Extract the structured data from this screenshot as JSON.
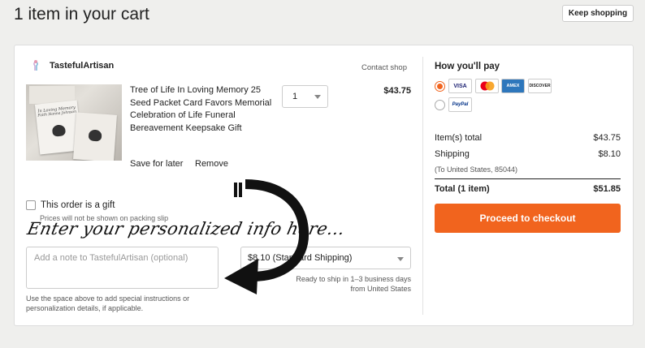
{
  "header": {
    "title": "1 item in your cart",
    "keep_shopping": "Keep shopping"
  },
  "shop": {
    "name": "TastefulArtisan",
    "contact": "Contact shop"
  },
  "item": {
    "title": "Tree of Life In Loving Memory 25 Seed Packet Card Favors Memorial Celebration of Life Funeral Bereavement Keepsake Gift",
    "quantity": "1",
    "price": "$43.75",
    "save_later": "Save for later",
    "remove": "Remove",
    "thumb_text_1": "In Loving Memory",
    "thumb_text_2": "Faith Hanna Johnson"
  },
  "gift": {
    "label": "This order is a gift",
    "sub": "Prices will not be shown on packing slip"
  },
  "annotation": {
    "text": "Enter your personalized info here..."
  },
  "note": {
    "placeholder": "Add a note to TastefulArtisan (optional)",
    "help": "Use the space above to add special instructions or personalization details, if applicable."
  },
  "shipping": {
    "selected": "$8.10 (Standard Shipping)",
    "info_line1": "Ready to ship in 1–3 business days",
    "info_line2": "from United States"
  },
  "payment": {
    "title": "How you'll pay",
    "methods": [
      "VISA",
      "Mastercard",
      "AMEX",
      "DISCOVER",
      "PayPal"
    ],
    "selected": "cards"
  },
  "summary": {
    "items_total_label": "Item(s) total",
    "items_total_value": "$43.75",
    "shipping_label": "Shipping",
    "shipping_value": "$8.10",
    "ship_to": "(To United States, 85044)",
    "total_label": "Total (1 item)",
    "total_value": "$51.85",
    "checkout": "Proceed to checkout"
  },
  "colors": {
    "accent": "#f1641e",
    "background": "#efefed"
  }
}
